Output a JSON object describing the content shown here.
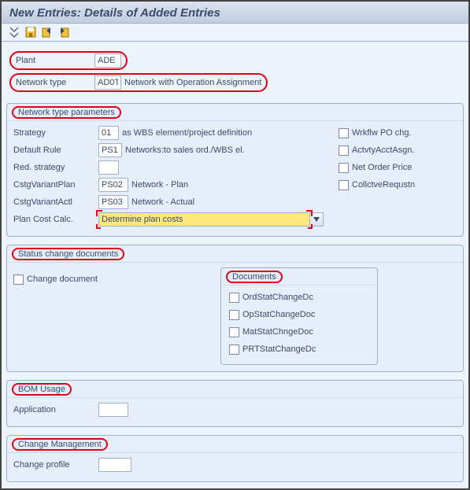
{
  "title": "New Entries: Details of Added Entries",
  "header": {
    "plant": {
      "label": "Plant",
      "value": "ADE"
    },
    "networkType": {
      "label": "Network type",
      "value": "AD0T",
      "desc": "Network with Operation Assignment"
    }
  },
  "params": {
    "title": "Network type parameters",
    "strategy": {
      "label": "Strategy",
      "value": "01",
      "desc": "as WBS element/project definition"
    },
    "defaultRule": {
      "label": "Default Rule",
      "value": "PS1",
      "desc": "Networks:to sales ord./WBS el."
    },
    "redStrategy": {
      "label": "Red. strategy",
      "value": ""
    },
    "cstgVarPlan": {
      "label": "CstgVariantPlan",
      "value": "PS02",
      "desc": "Network - Plan"
    },
    "cstgVarActl": {
      "label": "CstgVariantActl",
      "value": "PS03",
      "desc": "Network - Actual"
    },
    "planCostCalc": {
      "label": "Plan Cost Calc.",
      "value": "Determine plan costs"
    },
    "checks": {
      "wrkflw": "Wrkflw PO chg.",
      "actvty": "ActvtyAcctAsgn.",
      "netOrder": "Net Order Price",
      "collctv": "CollctveRequstn"
    }
  },
  "status": {
    "title": "Status change documents",
    "changeDoc": "Change document",
    "docsTitle": "Documents",
    "docs": {
      "ord": "OrdStatChangeDc",
      "op": "OpStatChangeDoc",
      "mat": "MatStatChngeDoc",
      "prt": "PRTStatChangeDc"
    }
  },
  "bom": {
    "title": "BOM Usage",
    "application": {
      "label": "Application",
      "value": ""
    }
  },
  "change": {
    "title": "Change Management",
    "profile": {
      "label": "Change profile",
      "value": ""
    }
  }
}
